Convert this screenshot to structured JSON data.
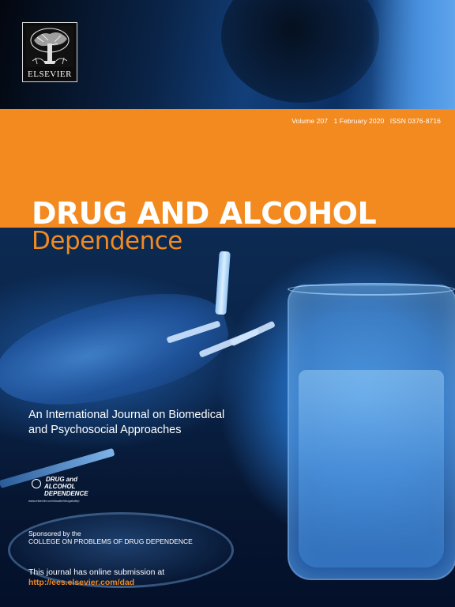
{
  "publisher": {
    "name": "ELSEVIER"
  },
  "issue": {
    "volume": "Volume 207",
    "date": "1 February 2020",
    "issn": "ISSN 0376-8716"
  },
  "journal": {
    "title_main": "DRUG AND ALCOHOL",
    "title_sub": "Dependence",
    "tagline_line1": "An International Journal on Biomedical",
    "tagline_line2": "and Psychosocial Approaches"
  },
  "badge": {
    "line1": "DRUG and",
    "line2": "ALCOHOL",
    "line3": "DEPENDENCE",
    "url": "www.elsevier.com/locate/drugalcdep"
  },
  "sponsor": {
    "label": "Sponsored by the",
    "org": "COLLEGE ON PROBLEMS OF DRUG DEPENDENCE"
  },
  "submission": {
    "text": "This journal has online submission at",
    "url": "http://ees.elsevier.com/dad"
  },
  "colors": {
    "accent_orange": "#f28a1f",
    "photo_blue": "#1e5ea8"
  }
}
